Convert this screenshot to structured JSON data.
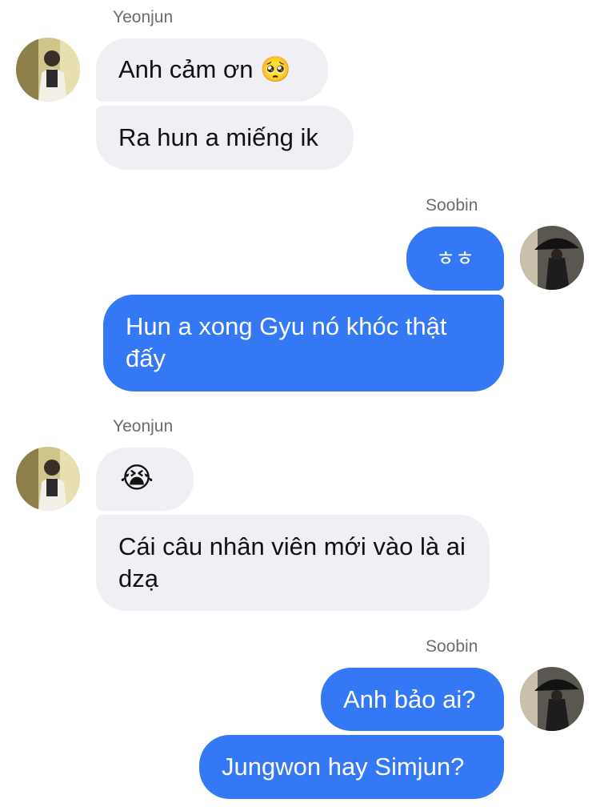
{
  "colors": {
    "incoming_bubble": "#f0f0f4",
    "outgoing_bubble": "#3478f6",
    "sender_name": "#6b6b70"
  },
  "groups": [
    {
      "sender": "Yeonjun",
      "messages": [
        "Anh cảm ơn 🥺",
        "Ra hun a miếng ik"
      ]
    },
    {
      "sender": "Soobin",
      "messages": [
        "ㅎㅎ",
        "Hun a xong Gyu nó khóc thật đấy"
      ]
    },
    {
      "sender": "Yeonjun",
      "messages": [
        "😭",
        "Cái câu nhân viên mới vào là ai dzạ"
      ]
    },
    {
      "sender": "Soobin",
      "messages": [
        "Anh bảo ai?",
        "Jungwon hay Simjun?"
      ]
    }
  ]
}
